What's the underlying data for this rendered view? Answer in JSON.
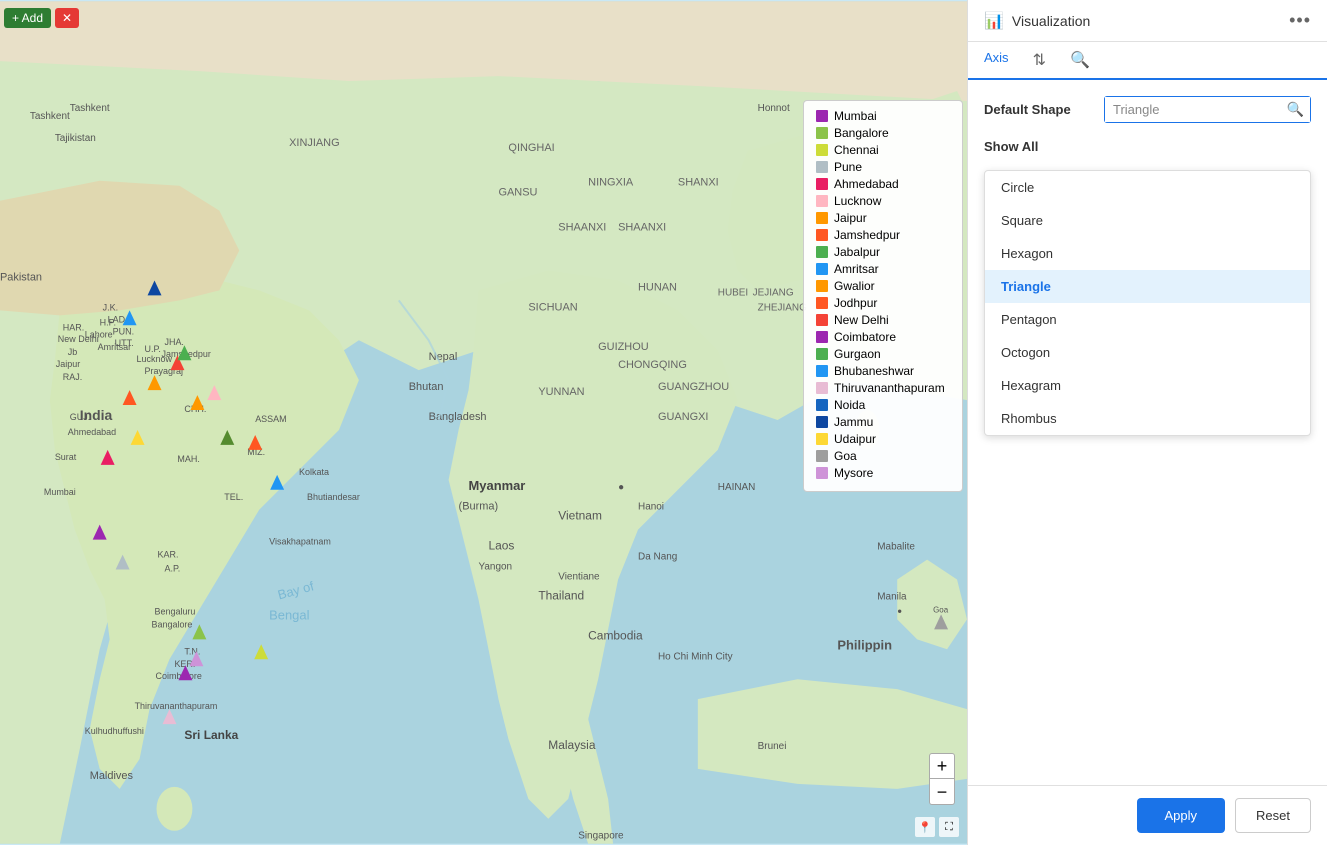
{
  "toolbar": {
    "add_label": "+ Add",
    "close_label": "✕"
  },
  "legend": {
    "items": [
      {
        "label": "Mumbai",
        "color": "#9c27b0"
      },
      {
        "label": "Bangalore",
        "color": "#8bc34a"
      },
      {
        "label": "Chennai",
        "color": "#cddc39"
      },
      {
        "label": "Pune",
        "color": "#b0bec5"
      },
      {
        "label": "Ahmedabad",
        "color": "#e91e63"
      },
      {
        "label": "Lucknow",
        "color": "#ffb6c1"
      },
      {
        "label": "Jaipur",
        "color": "#ff9800"
      },
      {
        "label": "Jamshedpur",
        "color": "#ff5722"
      },
      {
        "label": "Jabalpur",
        "color": "#4caf50"
      },
      {
        "label": "Amritsar",
        "color": "#2196f3"
      },
      {
        "label": "Gwalior",
        "color": "#ff9800"
      },
      {
        "label": "Jodhpur",
        "color": "#ff5722"
      },
      {
        "label": "New Delhi",
        "color": "#f44336"
      },
      {
        "label": "Coimbatore",
        "color": "#9c27b0"
      },
      {
        "label": "Gurgaon",
        "color": "#4caf50"
      },
      {
        "label": "Bhubaneshwar",
        "color": "#2196f3"
      },
      {
        "label": "Thiruvananthapuram",
        "color": "#e8bcd4"
      },
      {
        "label": "Noida",
        "color": "#1565c0"
      },
      {
        "label": "Jammu",
        "color": "#0d47a1"
      },
      {
        "label": "Udaipur",
        "color": "#fdd835"
      },
      {
        "label": "Goa",
        "color": "#9e9e9e"
      },
      {
        "label": "Mysore",
        "color": "#ce93d8"
      }
    ]
  },
  "panel": {
    "visualization_label": "Visualization",
    "more_icon": "•••",
    "tabs": [
      {
        "id": "axis",
        "label": "Axis",
        "active": false
      },
      {
        "id": "sort",
        "label": "",
        "icon": "⇅"
      },
      {
        "id": "search",
        "label": "",
        "icon": "🔍"
      }
    ],
    "axis_label": "Axis",
    "default_shape_label": "Default Shape",
    "show_all_label": "Show All",
    "search_placeholder": "Triangle",
    "shapes": [
      {
        "id": "circle",
        "label": "Circle",
        "selected": false
      },
      {
        "id": "square",
        "label": "Square",
        "selected": false
      },
      {
        "id": "hexagon",
        "label": "Hexagon",
        "selected": false
      },
      {
        "id": "triangle",
        "label": "Triangle",
        "selected": true
      },
      {
        "id": "pentagon",
        "label": "Pentagon",
        "selected": false
      },
      {
        "id": "octogon",
        "label": "Octogon",
        "selected": false
      },
      {
        "id": "hexagram",
        "label": "Hexagram",
        "selected": false
      },
      {
        "id": "rhombus",
        "label": "Rhombus",
        "selected": false
      }
    ],
    "apply_label": "Apply",
    "reset_label": "Reset"
  },
  "map_markers": [
    {
      "city": "Jammu",
      "x": 16,
      "y": 27,
      "color": "#0d47a1"
    },
    {
      "city": "Amritsar/JK area",
      "x": 15,
      "y": 29,
      "color": "#1565c0"
    },
    {
      "city": "New Delhi",
      "x": 18,
      "y": 37,
      "color": "#f44336"
    },
    {
      "city": "Jaipur",
      "x": 16,
      "y": 40,
      "color": "#ff9800"
    },
    {
      "city": "Ahmedabad",
      "x": 11,
      "y": 47,
      "color": "#e91e63"
    },
    {
      "city": "Mumbai",
      "x": 10,
      "y": 55,
      "color": "#9c27b0"
    },
    {
      "city": "Udaipur",
      "x": 14,
      "y": 43,
      "color": "#fdd835"
    },
    {
      "city": "Jodhpur",
      "x": 14,
      "y": 41,
      "color": "#ff5722"
    },
    {
      "city": "Gwalior",
      "x": 20,
      "y": 39,
      "color": "#ff9800"
    },
    {
      "city": "Lucknow",
      "x": 22,
      "y": 37,
      "color": "#ffb6c1"
    },
    {
      "city": "Jamshedpur",
      "x": 27,
      "y": 45,
      "color": "#ff5722"
    },
    {
      "city": "Gurgaon",
      "x": 18,
      "y": 36,
      "color": "#4caf50"
    },
    {
      "city": "Noida",
      "x": 19,
      "y": 36,
      "color": "#1565c0"
    },
    {
      "city": "Bangalore",
      "x": 20,
      "y": 66,
      "color": "#8bc34a"
    },
    {
      "city": "Coimbatore",
      "x": 19,
      "y": 68,
      "color": "#9c27b0"
    },
    {
      "city": "Chennai",
      "x": 23,
      "y": 65,
      "color": "#cddc39"
    },
    {
      "city": "Goa",
      "x": 91,
      "y": 63,
      "color": "#9e9e9e"
    },
    {
      "city": "Pune",
      "x": 13,
      "y": 56,
      "color": "#b0bec5"
    },
    {
      "city": "Mysore",
      "x": 19,
      "y": 67,
      "color": "#ce93d8"
    }
  ]
}
